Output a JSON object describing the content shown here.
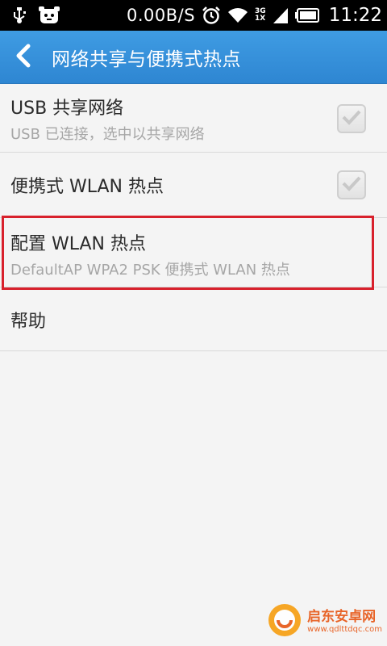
{
  "status_bar": {
    "net_speed": "0.00B/S",
    "net_type_top": "3G",
    "net_type_bottom": "1X",
    "time": "11:22",
    "icons": [
      "usb-icon",
      "notification-app-icon",
      "alarm-icon",
      "wifi-icon",
      "signal-icon",
      "battery-icon"
    ]
  },
  "title_bar": {
    "title": "网络共享与便携式热点",
    "back_icon": "chevron-left-icon"
  },
  "settings": [
    {
      "title": "USB 共享网络",
      "subtitle": "USB 已连接，选中以共享网络",
      "checked": true
    },
    {
      "title": "便携式 WLAN 热点",
      "checked": true
    },
    {
      "title": "配置 WLAN 热点",
      "subtitle": "DefaultAP WPA2 PSK 便携式 WLAN 热点"
    },
    {
      "title": "帮助"
    }
  ],
  "watermark": {
    "title": "启东安卓网",
    "url": "www.qdlttdqc.com"
  },
  "colors": {
    "title_bar": "#3597de",
    "highlight": "#d8212c",
    "background": "#f4f4f4"
  }
}
